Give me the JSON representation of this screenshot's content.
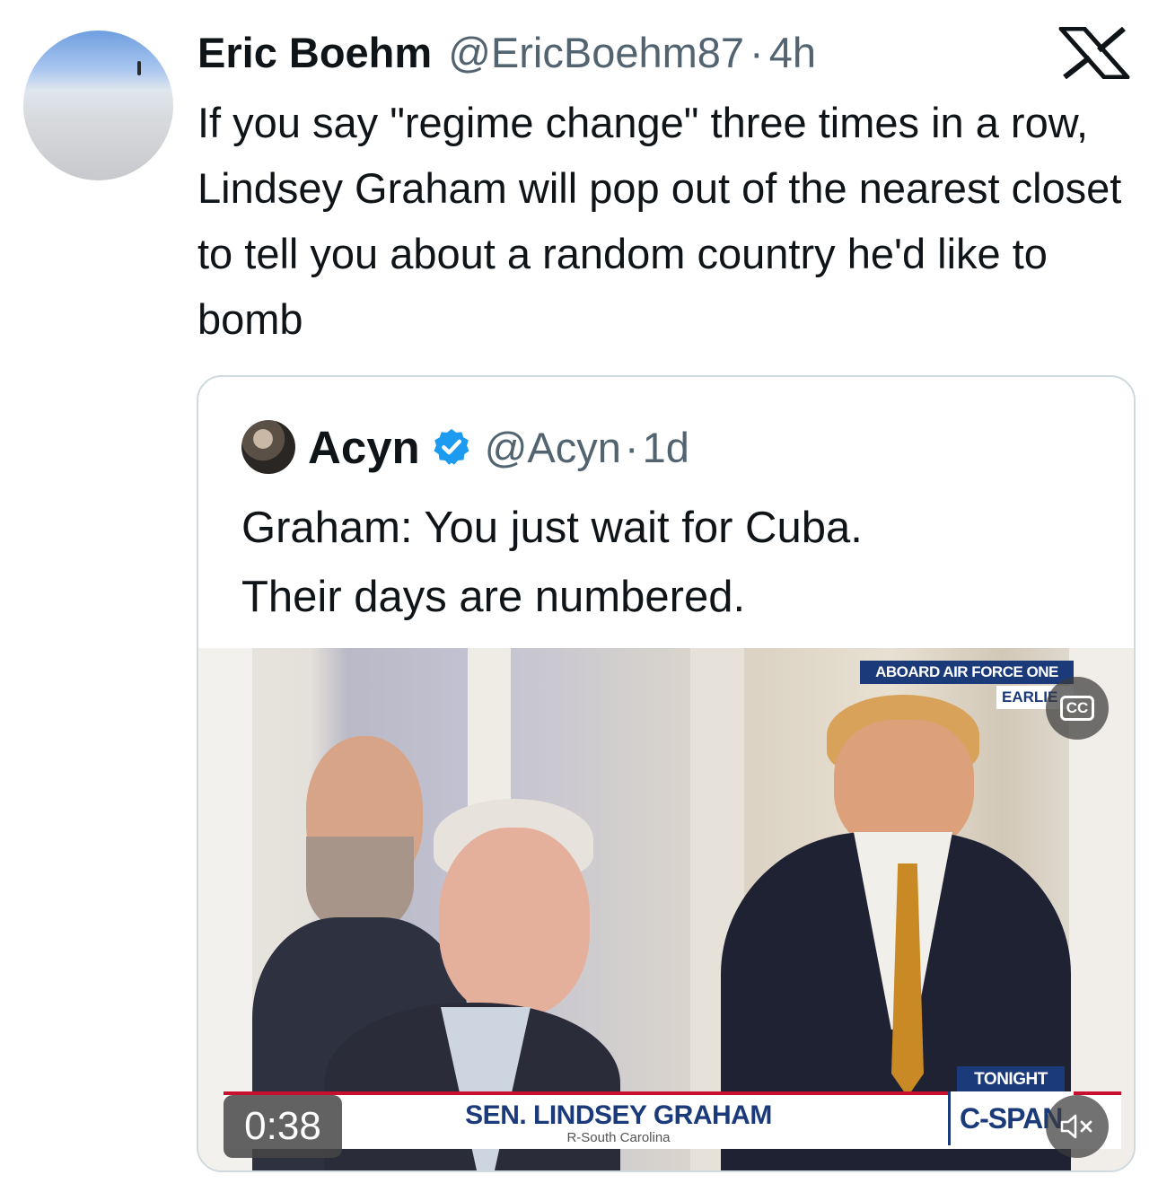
{
  "tweet": {
    "author_name": "Eric Boehm",
    "handle": "@EricBoehm87",
    "separator": "·",
    "time": "4h",
    "text": "If you say \"regime change\" three times in a row, Lindsey Graham will pop out of the nearest closet to tell you about a random country he'd like to bomb"
  },
  "icons": {
    "platform": "x-logo-icon",
    "verified": "verified-badge-icon",
    "captions": "closed-captions-icon",
    "mute": "speaker-muted-icon"
  },
  "quote": {
    "author_name": "Acyn",
    "handle": "@Acyn",
    "separator": "·",
    "time": "1d",
    "text_line1": "Graham: You just wait for Cuba.",
    "text_line2": "Their days are numbered.",
    "verified_color": "#1d9bf0"
  },
  "video": {
    "duration": "0:38",
    "cc_label": "CC",
    "overlay_tag": "ABOARD AIR FORCE ONE",
    "overlay_tag2": "EARLIE",
    "lower_third_name": "SEN. LINDSEY GRAHAM",
    "lower_third_sub": "R-South Carolina",
    "tonight_label": "TONIGHT",
    "network_label": "C-SPAN",
    "muted": true
  }
}
